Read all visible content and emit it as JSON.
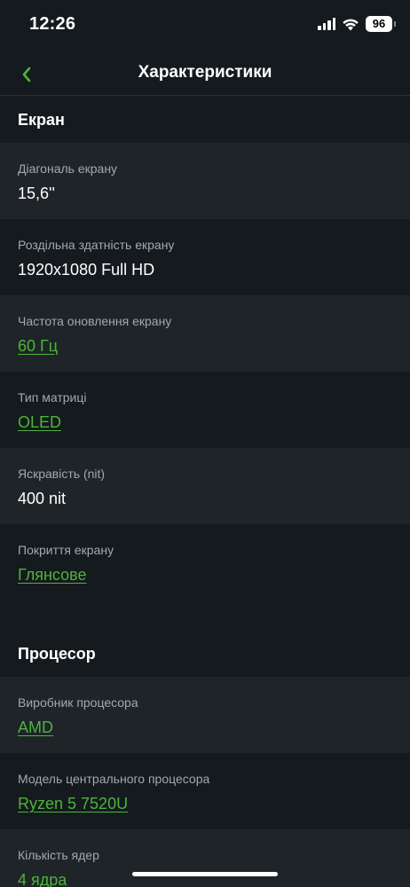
{
  "status_bar": {
    "time": "12:26",
    "battery": "96"
  },
  "header": {
    "title": "Характеристики"
  },
  "sections": [
    {
      "title": "Екран",
      "rows": [
        {
          "label": "Діагональ екрану",
          "value": "15,6''",
          "link": false
        },
        {
          "label": "Роздільна здатність екрану",
          "value": "1920x1080 Full HD",
          "link": false
        },
        {
          "label": "Частота оновлення екрану",
          "value": "60 Гц",
          "link": true
        },
        {
          "label": "Тип матриці",
          "value": "OLED",
          "link": true
        },
        {
          "label": "Яскравість (nit)",
          "value": "400 nit",
          "link": false
        },
        {
          "label": "Покриття екрану",
          "value": "Глянсове",
          "link": true
        }
      ]
    },
    {
      "title": "Процесор",
      "rows": [
        {
          "label": "Виробник процесора",
          "value": "AMD",
          "link": true
        },
        {
          "label": "Модель центрального процесора",
          "value": "Ryzen 5 7520U",
          "link": true
        },
        {
          "label": "Кількість ядер",
          "value": "4 ядра",
          "link": true
        }
      ]
    }
  ],
  "colors": {
    "background": "#151a1e",
    "row_alt": "#1f2429",
    "accent": "#4cb43a",
    "label": "#a3a8ad"
  }
}
